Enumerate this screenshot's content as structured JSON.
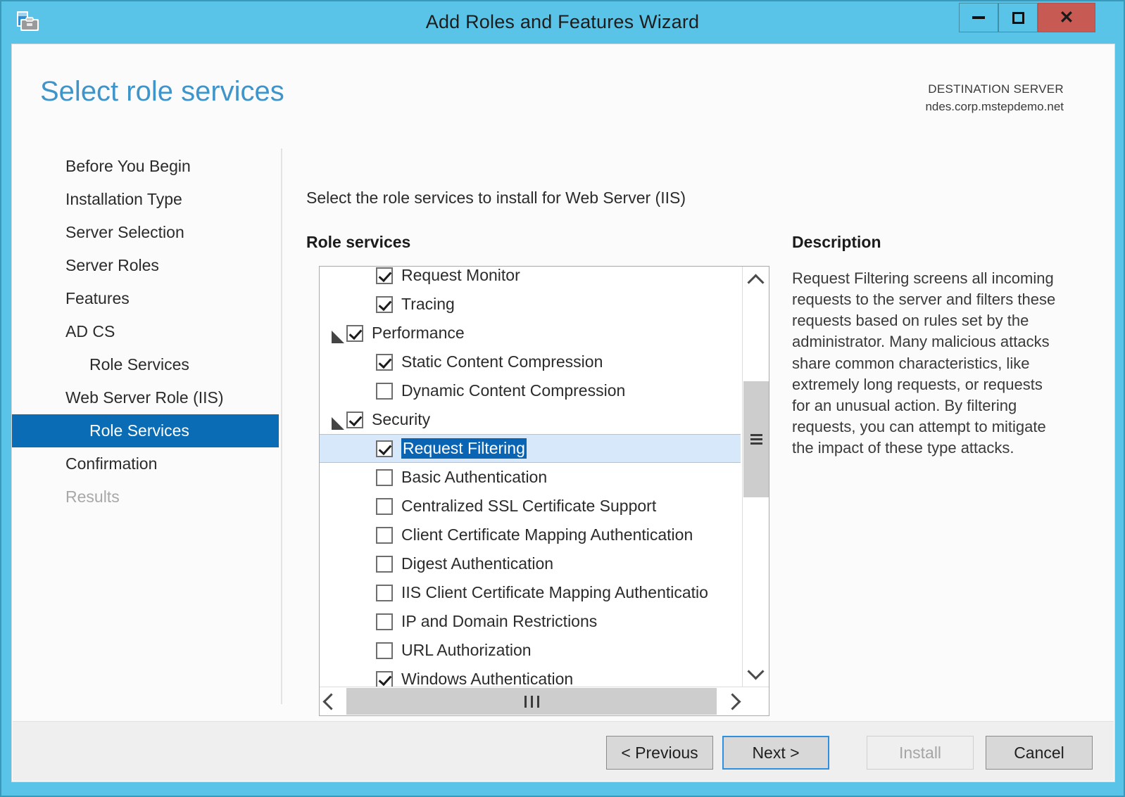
{
  "window": {
    "title": "Add Roles and Features Wizard",
    "icon": "wizard-toolbox-icon",
    "controls": {
      "minimize": "–",
      "maximize": "□",
      "close": "✕"
    },
    "accent_color": "#59c4e8",
    "close_color": "#c75b54"
  },
  "header": {
    "page_title": "Select role services",
    "destination_label": "DESTINATION SERVER",
    "destination_server": "ndes.corp.mstepdemo.net",
    "title_color": "#3f94c9"
  },
  "sidebar": {
    "selected_color": "#0a6cb4",
    "items": [
      {
        "label": "Before You Begin",
        "indent": false,
        "state": "normal"
      },
      {
        "label": "Installation Type",
        "indent": false,
        "state": "normal"
      },
      {
        "label": "Server Selection",
        "indent": false,
        "state": "normal"
      },
      {
        "label": "Server Roles",
        "indent": false,
        "state": "normal"
      },
      {
        "label": "Features",
        "indent": false,
        "state": "normal"
      },
      {
        "label": "AD CS",
        "indent": false,
        "state": "normal"
      },
      {
        "label": "Role Services",
        "indent": true,
        "state": "normal"
      },
      {
        "label": "Web Server Role (IIS)",
        "indent": false,
        "state": "normal"
      },
      {
        "label": "Role Services",
        "indent": true,
        "state": "selected"
      },
      {
        "label": "Confirmation",
        "indent": false,
        "state": "normal"
      },
      {
        "label": "Results",
        "indent": false,
        "state": "disabled"
      }
    ]
  },
  "main": {
    "instruction": "Select the role services to install for Web Server (IIS)",
    "role_services_label": "Role services",
    "description_label": "Description",
    "description_text": "Request Filtering screens all incoming requests to the server and filters these requests based on rules set by the administrator. Many malicious attacks share common characteristics, like extremely long requests, or requests for an unusual action. By filtering requests, you can attempt to mitigate the impact of these type attacks.",
    "tree": [
      {
        "label": "Request Monitor",
        "level": 2,
        "checked": true,
        "expander": false,
        "selected": false,
        "clipped_top": true
      },
      {
        "label": "Tracing",
        "level": 2,
        "checked": true,
        "expander": false,
        "selected": false
      },
      {
        "label": "Performance",
        "level": 1,
        "checked": true,
        "expander": true,
        "selected": false
      },
      {
        "label": "Static Content Compression",
        "level": 2,
        "checked": true,
        "expander": false,
        "selected": false
      },
      {
        "label": "Dynamic Content Compression",
        "level": 2,
        "checked": false,
        "expander": false,
        "selected": false
      },
      {
        "label": "Security",
        "level": 1,
        "checked": true,
        "expander": true,
        "selected": false
      },
      {
        "label": "Request Filtering",
        "level": 2,
        "checked": true,
        "expander": false,
        "selected": true
      },
      {
        "label": "Basic Authentication",
        "level": 2,
        "checked": false,
        "expander": false,
        "selected": false
      },
      {
        "label": "Centralized SSL Certificate Support",
        "level": 2,
        "checked": false,
        "expander": false,
        "selected": false
      },
      {
        "label": "Client Certificate Mapping Authentication",
        "level": 2,
        "checked": false,
        "expander": false,
        "selected": false
      },
      {
        "label": "Digest Authentication",
        "level": 2,
        "checked": false,
        "expander": false,
        "selected": false
      },
      {
        "label": "IIS Client Certificate Mapping Authenticatio",
        "level": 2,
        "checked": false,
        "expander": false,
        "selected": false,
        "clipped_right": true
      },
      {
        "label": "IP and Domain Restrictions",
        "level": 2,
        "checked": false,
        "expander": false,
        "selected": false
      },
      {
        "label": "URL Authorization",
        "level": 2,
        "checked": false,
        "expander": false,
        "selected": false
      },
      {
        "label": "Windows Authentication",
        "level": 2,
        "checked": true,
        "expander": false,
        "selected": false,
        "clipped_bottom": true
      }
    ],
    "selection_highlight_color": "#0a64b4",
    "selected_row_background": "#d6e8fa"
  },
  "scrollbars": {
    "vertical": {
      "up_arrow": "chevron-up",
      "down_arrow": "chevron-down",
      "thumb_position_pct": 28,
      "thumb_size_pct": 28
    },
    "horizontal": {
      "left_arrow": "chevron-left",
      "right_arrow": "chevron-right",
      "thumb_position_pct": 0,
      "thumb_size_pct": 83
    }
  },
  "footer": {
    "previous": "< Previous",
    "next": "Next >",
    "install": "Install",
    "cancel": "Cancel",
    "install_enabled": false,
    "next_focused": true
  }
}
